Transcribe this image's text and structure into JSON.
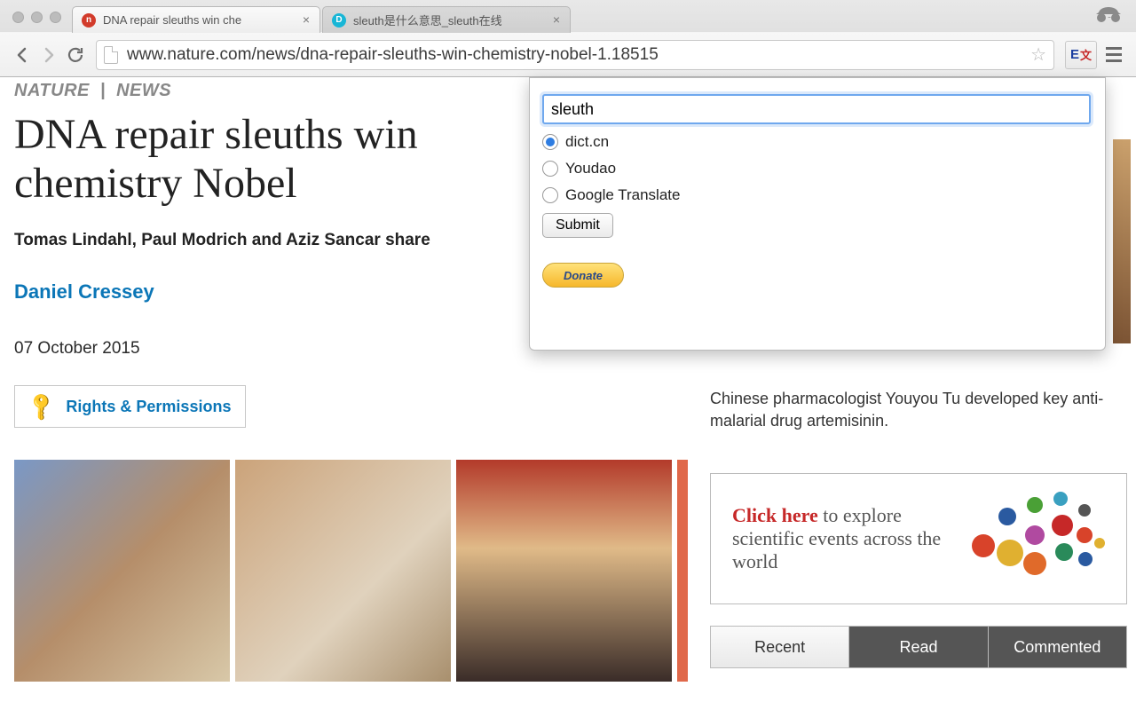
{
  "browser": {
    "tabs": [
      {
        "title": "DNA repair sleuths win che",
        "favicon_color": "#d23b2b",
        "favicon_letter": "n"
      },
      {
        "title": "sleuth是什么意思_sleuth在线",
        "favicon_color": "#18b6d6",
        "favicon_letter": "D"
      }
    ],
    "url_display": "www.nature.com/news/dna-repair-sleuths-win-chemistry-nobel-1.18515",
    "ext_label_e": "E",
    "ext_label_cn": "文"
  },
  "page": {
    "breadcrumb_a": "NATURE",
    "breadcrumb_sep": "|",
    "breadcrumb_b": "NEWS",
    "headline": "DNA repair sleuths win chemistry Nobel",
    "subhead": "Tomas Lindahl, Paul Modrich and Aziz Sancar share",
    "author": "Daniel Cressey",
    "date": "07 October 2015",
    "rights": "Rights & Permissions"
  },
  "sidebar": {
    "text": "Chinese pharmacologist Youyou Tu developed key anti-malarial drug artemisinin.",
    "promo_click": "Click here",
    "promo_rest": " to explore scientific events across the world",
    "tabs": [
      "Recent",
      "Read",
      "Commented"
    ]
  },
  "popup": {
    "search_value": "sleuth",
    "options": [
      "dict.cn",
      "Youdao",
      "Google Translate"
    ],
    "selected_index": 0,
    "submit_label": "Submit",
    "donate_label": "Donate"
  }
}
